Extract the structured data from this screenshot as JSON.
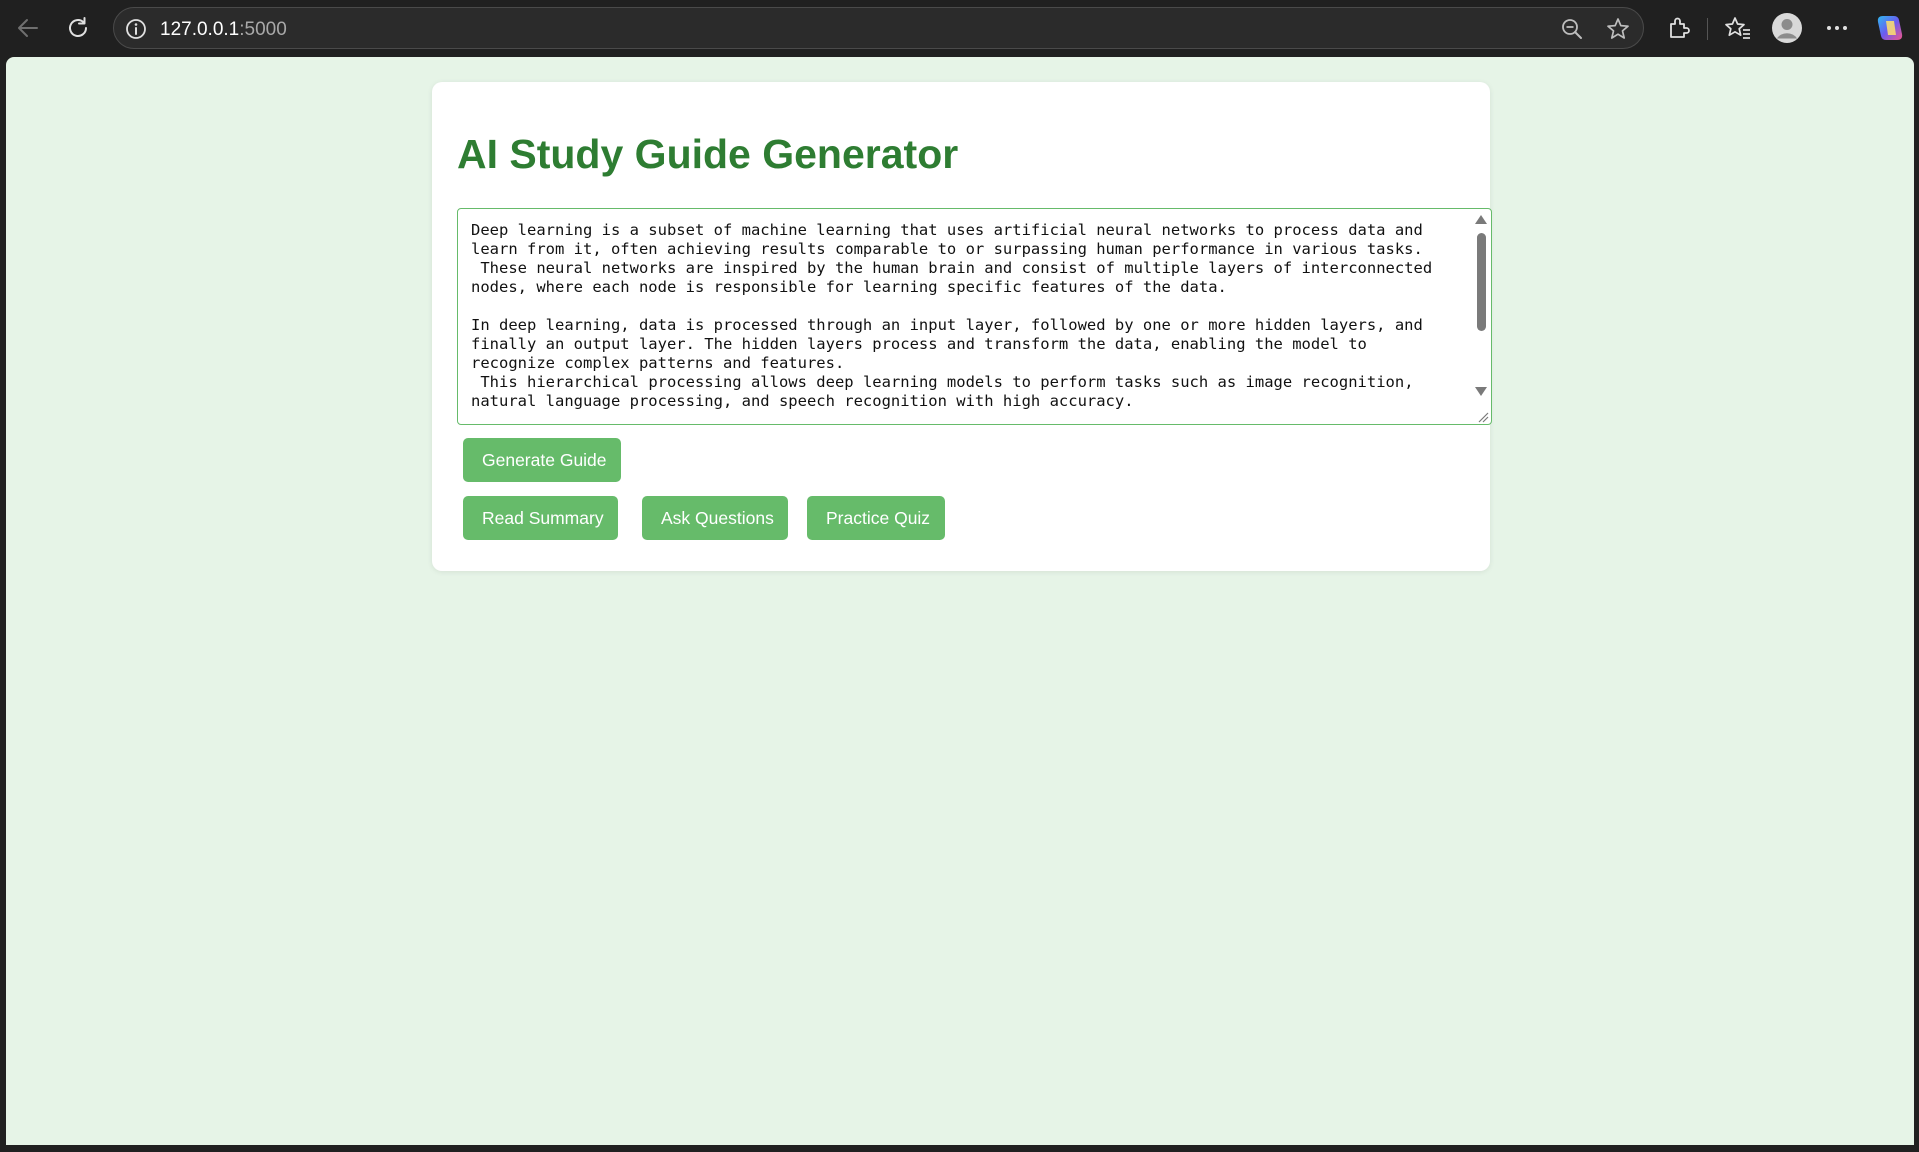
{
  "browser": {
    "url_host": "127.0.0.1",
    "url_port": ":5000",
    "icons": [
      "back-arrow-icon",
      "refresh-icon",
      "site-info-icon",
      "zoom-out-icon",
      "favorite-star-icon",
      "extensions-icon",
      "favorites-icon",
      "profile-avatar-icon",
      "more-menu-icon",
      "copilot-icon"
    ]
  },
  "page": {
    "title": "AI Study Guide Generator",
    "input_text": "Deep learning is a subset of machine learning that uses artificial neural networks to process data and learn from it, often achieving results comparable to or surpassing human performance in various tasks.\n These neural networks are inspired by the human brain and consist of multiple layers of interconnected nodes, where each node is responsible for learning specific features of the data.\n\nIn deep learning, data is processed through an input layer, followed by one or more hidden layers, and finally an output layer. The hidden layers process and transform the data, enabling the model to recognize complex patterns and features.\n This hierarchical processing allows deep learning models to perform tasks such as image recognition, natural language processing, and speech recognition with high accuracy.",
    "generate_label": "Generate Guide",
    "read_summary_label": "Read Summary",
    "ask_questions_label": "Ask Questions",
    "practice_quiz_label": "Practice Quiz"
  },
  "colors": {
    "page_bg": "#e6f4e7",
    "title": "#2e7d32",
    "button": "#66bb6a",
    "button_text": "#ffffff",
    "textarea_border": "#66bb6a",
    "browser_chrome": "#202020"
  }
}
